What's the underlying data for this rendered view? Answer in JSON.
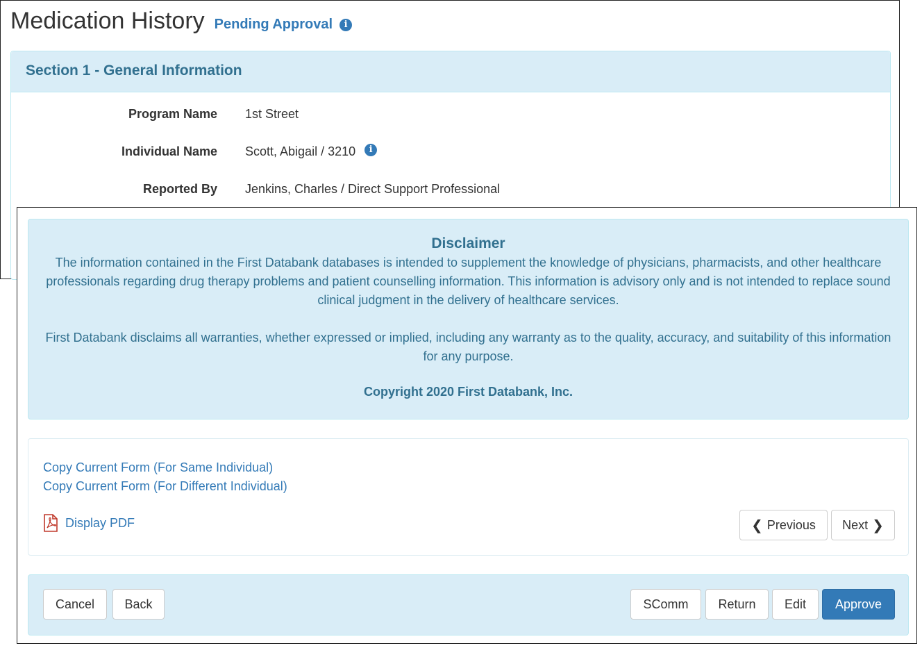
{
  "header": {
    "title": "Medication History",
    "status": "Pending Approval",
    "status_icon": "info-circle-icon"
  },
  "section": {
    "heading": "Section 1 - General Information",
    "fields": [
      {
        "label": "Program Name",
        "value": "1st Street"
      },
      {
        "label": "Individual Name",
        "value": "Scott, Abigail / 3210"
      },
      {
        "label": "Reported By",
        "value": "Jenkins, Charles / Direct Support Professional"
      }
    ]
  },
  "disclaimer": {
    "title": "Disclaimer",
    "paragraph1": "The information contained in the First Databank databases is intended to supplement the knowledge of physicians, pharmacists, and other healthcare professionals regarding drug therapy problems and patient counselling information. This information is advisory only and is not intended to replace sound clinical judgment in the delivery of healthcare services.",
    "paragraph2": "First Databank disclaims all warranties, whether expressed or implied, including any warranty as to the quality, accuracy, and suitability of this information for any purpose.",
    "copyright": "Copyright 2020 First Databank, Inc."
  },
  "links": {
    "copy_same": "Copy Current Form (For Same Individual)",
    "copy_different": "Copy Current Form (For Different Individual)",
    "display_pdf": "Display PDF"
  },
  "pager": {
    "previous": "Previous",
    "next": "Next"
  },
  "actions": {
    "cancel": "Cancel",
    "back": "Back",
    "scomm": "SComm",
    "return": "Return",
    "edit": "Edit",
    "approve": "Approve"
  },
  "colors": {
    "accent": "#337ab7",
    "info_bg": "#d9edf7",
    "info_text": "#31708f",
    "pdf_red": "#c0392b"
  }
}
